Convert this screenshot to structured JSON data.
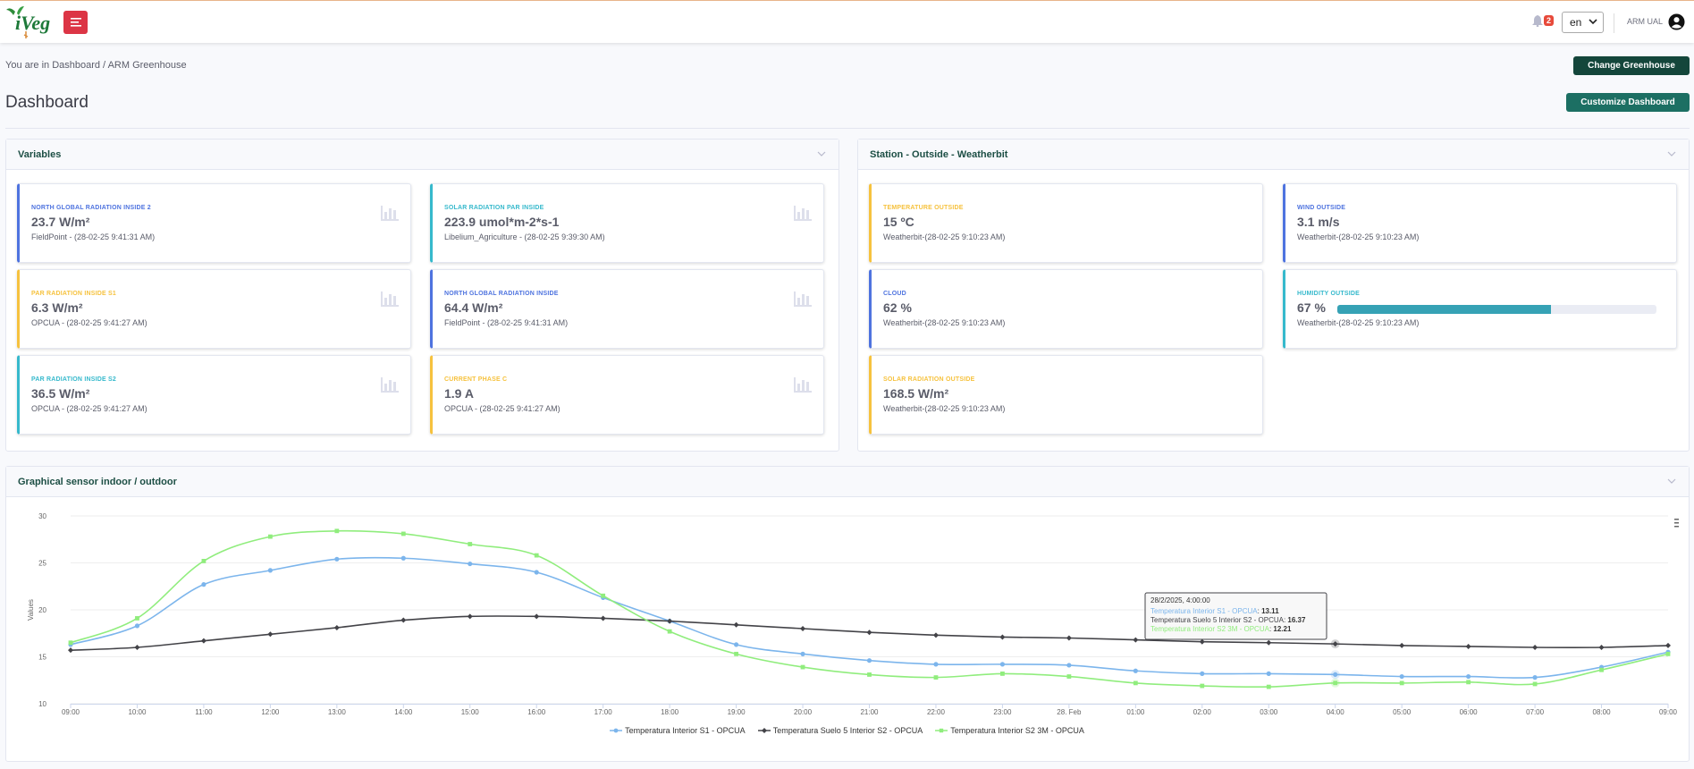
{
  "header": {
    "app_name": "iVeg",
    "notifications_count": "2",
    "language": "en",
    "user_name": "ARM UAL"
  },
  "breadcrumb": "You are in Dashboard / ARM Greenhouse",
  "buttons": {
    "change_greenhouse": "Change Greenhouse",
    "customize_dashboard": "Customize Dashboard"
  },
  "page_title": "Dashboard",
  "variables_panel": {
    "title": "Variables",
    "cards": [
      {
        "label": "NORTH GLOBAL RADIATION INSIDE 2",
        "value": "23.7 W/m²",
        "source": "FieldPoint - (28-02-25 9:41:31 AM)",
        "accent": "#4e73df"
      },
      {
        "label": "SOLAR RADIATION PAR INSIDE",
        "value": "223.9 umol*m-2*s-1",
        "source": "Libelium_Agriculture - (28-02-25 9:39:30 AM)",
        "accent": "#36b9cc"
      },
      {
        "label": "PAR RADIATION INSIDE S1",
        "value": "6.3 W/m²",
        "source": "OPCUA - (28-02-25 9:41:27 AM)",
        "accent": "#f6c23e"
      },
      {
        "label": "NORTH GLOBAL RADIATION INSIDE",
        "value": "64.4 W/m²",
        "source": "FieldPoint - (28-02-25 9:41:31 AM)",
        "accent": "#4e73df"
      },
      {
        "label": "PAR RADIATION INSIDE S2",
        "value": "36.5 W/m²",
        "source": "OPCUA - (28-02-25 9:41:27 AM)",
        "accent": "#36b9cc"
      },
      {
        "label": "CURRENT PHASE C",
        "value": "1.9 A",
        "source": "OPCUA - (28-02-25 9:41:27 AM)",
        "accent": "#f6c23e"
      }
    ]
  },
  "station_panel": {
    "title": "Station - Outside - Weatherbit",
    "cards": [
      {
        "label": "TEMPERATURE OUTSIDE",
        "value": "15 ºC",
        "source": "Weatherbit-(28-02-25 9:10:23 AM)",
        "accent": "#f6c23e"
      },
      {
        "label": "WIND OUTSIDE",
        "value": "3.1 m/s",
        "source": "Weatherbit-(28-02-25 9:10:23 AM)",
        "accent": "#4e73df"
      },
      {
        "label": "CLOUD",
        "value": "62 %",
        "source": "Weatherbit-(28-02-25 9:10:23 AM)",
        "accent": "#4e73df"
      },
      {
        "label": "HUMIDITY OUTSIDE",
        "value": "67 %",
        "source": "Weatherbit-(28-02-25 9:10:23 AM)",
        "accent": "#36b9cc",
        "progress": 0.67
      },
      {
        "label": "SOLAR RADIATION OUTSIDE",
        "value": "168.5 W/m²",
        "source": "Weatherbit-(28-02-25 9:10:23 AM)",
        "accent": "#f6c23e"
      }
    ]
  },
  "graph_panel": {
    "title": "Graphical sensor indoor / outdoor"
  },
  "chart_data": {
    "type": "line",
    "ylabel": "Values",
    "xlabel": "",
    "ylim": [
      10,
      30
    ],
    "yticks": [
      10,
      15,
      20,
      25,
      30
    ],
    "categories": [
      "09:00",
      "10:00",
      "11:00",
      "12:00",
      "13:00",
      "14:00",
      "15:00",
      "16:00",
      "17:00",
      "18:00",
      "19:00",
      "20:00",
      "21:00",
      "22:00",
      "23:00",
      "28. Feb",
      "01:00",
      "02:00",
      "03:00",
      "04:00",
      "05:00",
      "06:00",
      "07:00",
      "08:00",
      "09:00"
    ],
    "grid": true,
    "legend": "bottom",
    "series": [
      {
        "name": "Temperatura Interior S1 - OPCUA",
        "color": "#7cb5ec",
        "marker": "circle",
        "values": [
          16.3,
          18.3,
          22.7,
          24.2,
          25.4,
          25.5,
          24.9,
          24.0,
          21.3,
          18.8,
          16.3,
          15.3,
          14.6,
          14.2,
          14.2,
          14.1,
          13.5,
          13.2,
          13.2,
          13.11,
          12.9,
          12.9,
          12.8,
          13.9,
          15.5
        ]
      },
      {
        "name": "Temperatura Suelo 5 Interior S2 - OPCUA",
        "color": "#434348",
        "marker": "diamond",
        "values": [
          15.7,
          16.0,
          16.7,
          17.4,
          18.1,
          18.9,
          19.3,
          19.3,
          19.1,
          18.8,
          18.4,
          18.0,
          17.6,
          17.3,
          17.1,
          17.0,
          16.8,
          16.6,
          16.5,
          16.37,
          16.2,
          16.1,
          16.0,
          16.0,
          16.2
        ]
      },
      {
        "name": "Temperatura Interior S2 3M - OPCUA",
        "color": "#90ed7d",
        "marker": "square",
        "values": [
          16.5,
          19.1,
          25.2,
          27.8,
          28.4,
          28.1,
          27.0,
          25.8,
          21.5,
          17.7,
          15.3,
          13.9,
          13.1,
          12.8,
          13.2,
          12.9,
          12.2,
          11.9,
          11.8,
          12.21,
          12.2,
          12.3,
          12.1,
          13.6,
          15.3
        ]
      }
    ],
    "tooltip": {
      "title": "28/2/2025, 4:00:00",
      "index": 19,
      "rows": [
        {
          "name": "Temperatura Interior S1 - OPCUA",
          "value": "13.11",
          "color": "#7cb5ec"
        },
        {
          "name": "Temperatura Suelo 5 Interior S2 - OPCUA",
          "value": "16.37",
          "color": "#434348"
        },
        {
          "name": "Temperatura Interior S2 3M - OPCUA",
          "value": "12.21",
          "color": "#90ed7d"
        }
      ]
    }
  }
}
